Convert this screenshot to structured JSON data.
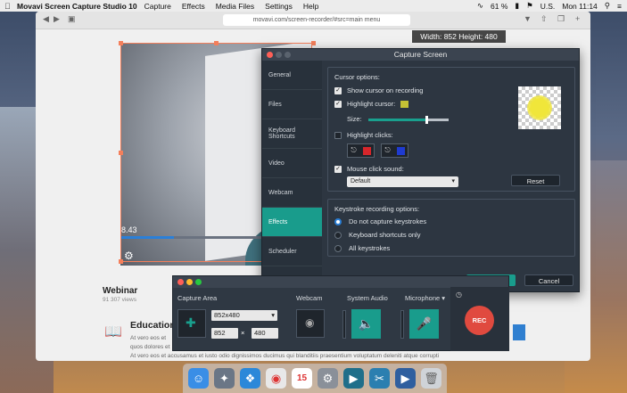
{
  "menubar": {
    "app": "Movavi Screen Capture Studio 10",
    "items": [
      "Capture",
      "Effects",
      "Media Files",
      "Settings",
      "Help"
    ],
    "battery": "61 %",
    "locale": "U.S.",
    "clock": "Mon 11:14",
    "battery_icon": "battery-icon",
    "wifi_icon": "wifi-icon",
    "search_icon": "search-icon"
  },
  "browser": {
    "url": "movavi.com/screen-recorder/#src=main menu"
  },
  "capture": {
    "size_label": "Width: 852  Height: 480",
    "video_time": "8.43"
  },
  "page": {
    "webinar_title": "Webinar",
    "views": "91 307 views",
    "edu_title": "Education",
    "lorem1": "At vero eos et",
    "lorem2": "quos dolores et",
    "lorem3": "At vero eos et accusamus et iusto odio dignissimos ducimus qui blanditiis praesentium voluptatum deleniti atque corrupti"
  },
  "dialog": {
    "title": "Capture Screen",
    "sidebar": [
      "General",
      "Files",
      "Keyboard Shortcuts",
      "Video",
      "Webcam",
      "Effects",
      "Scheduler",
      "Sharing"
    ],
    "active_tab": "Effects",
    "cursor_options_title": "Cursor options:",
    "show_cursor": "Show cursor on recording",
    "highlight_cursor": "Highlight cursor:",
    "size_label": "Size:",
    "highlight_clicks": "Highlight clicks:",
    "mouse_click_sound": "Mouse click sound:",
    "sound_value": "Default",
    "reset": "Reset",
    "keystroke_title": "Keystroke recording options:",
    "ks_opt1": "Do not capture keystrokes",
    "ks_opt2": "Keyboard shortcuts only",
    "ks_opt3": "All keystrokes",
    "ok": "OK",
    "cancel": "Cancel",
    "cursor_size_fraction": 0.72,
    "colors": {
      "accent": "#199c8c",
      "highlight": "#c6c235",
      "click_left": "#d6262b",
      "click_right": "#1f3bd0"
    }
  },
  "panel": {
    "capture_area": "Capture Area",
    "resolution": "852x480",
    "width": "852",
    "times": "×",
    "height": "480",
    "webcam": "Webcam",
    "system_audio": "System Audio",
    "microphone": "Microphone ▾",
    "rec": "REC"
  },
  "dock": {
    "icons": [
      "finder-icon",
      "launchpad-icon",
      "safari-icon",
      "chrome-icon",
      "calendar-icon",
      "system-preferences-icon",
      "movavi-icon",
      "movavi-editor-icon",
      "movavi-player-icon",
      "trash-icon"
    ],
    "calendar_day": "15"
  }
}
